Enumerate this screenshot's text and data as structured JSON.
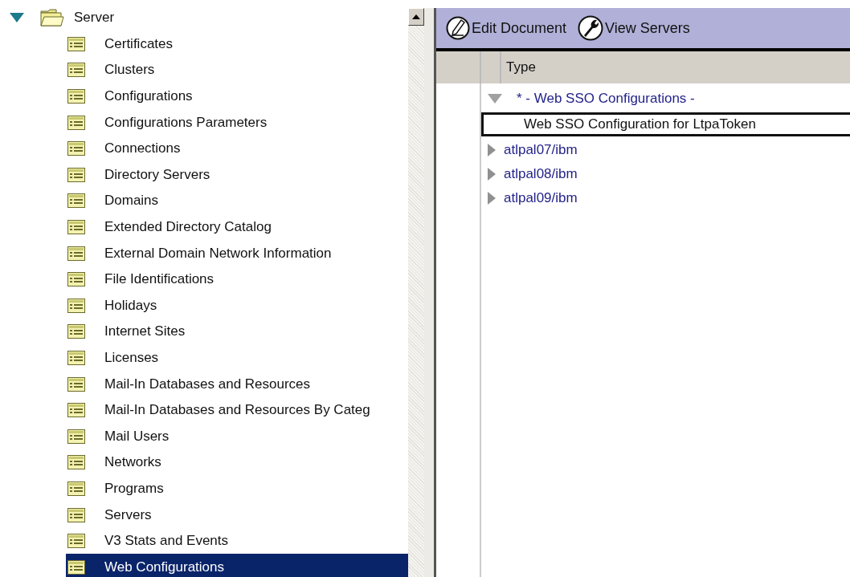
{
  "sidebar": {
    "root": {
      "label": "Server",
      "expanded": true,
      "children": [
        {
          "label": "Certificates",
          "selected": false
        },
        {
          "label": "Clusters",
          "selected": false
        },
        {
          "label": "Configurations",
          "selected": false
        },
        {
          "label": "Configurations Parameters",
          "selected": false
        },
        {
          "label": "Connections",
          "selected": false
        },
        {
          "label": "Directory Servers",
          "selected": false
        },
        {
          "label": "Domains",
          "selected": false
        },
        {
          "label": "Extended Directory Catalog",
          "selected": false
        },
        {
          "label": "External Domain Network Information",
          "selected": false
        },
        {
          "label": "File Identifications",
          "selected": false
        },
        {
          "label": "Holidays",
          "selected": false
        },
        {
          "label": "Internet Sites",
          "selected": false
        },
        {
          "label": "Licenses",
          "selected": false
        },
        {
          "label": "Mail-In Databases and Resources",
          "selected": false
        },
        {
          "label": "Mail-In Databases and Resources By Categ",
          "selected": false
        },
        {
          "label": "Mail Users",
          "selected": false
        },
        {
          "label": "Networks",
          "selected": false
        },
        {
          "label": "Programs",
          "selected": false
        },
        {
          "label": "Servers",
          "selected": false
        },
        {
          "label": "V3 Stats and Events",
          "selected": false
        },
        {
          "label": "Web Configurations",
          "selected": true
        }
      ]
    }
  },
  "toolbar": {
    "buttons": [
      {
        "kind": "pencil",
        "label": "Edit Document"
      },
      {
        "kind": "wrench",
        "label": "View Servers"
      }
    ]
  },
  "view": {
    "columns": [
      "Type"
    ],
    "rows": [
      {
        "kind": "category",
        "label": "* - Web SSO Configurations -",
        "expanded": true
      },
      {
        "kind": "document",
        "label": "Web SSO Configuration for LtpaToken",
        "selected": true
      },
      {
        "kind": "category",
        "label": "atlpal07/ibm",
        "expanded": false
      },
      {
        "kind": "category",
        "label": "atlpal08/ibm",
        "expanded": false
      },
      {
        "kind": "category",
        "label": "atlpal09/ibm",
        "expanded": false
      }
    ]
  }
}
